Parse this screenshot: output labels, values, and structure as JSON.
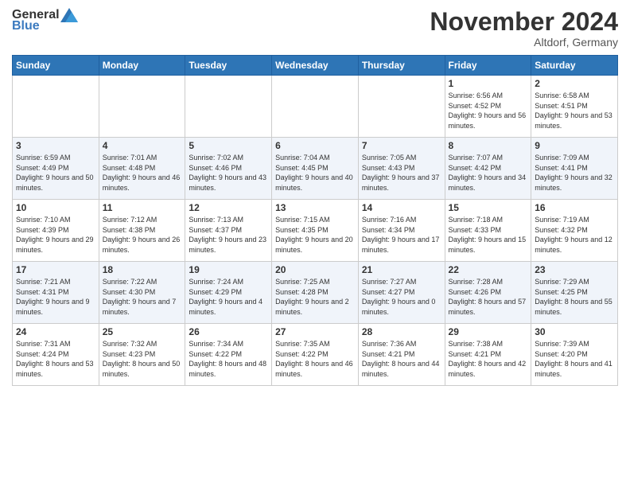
{
  "header": {
    "logo_general": "General",
    "logo_blue": "Blue",
    "month_title": "November 2024",
    "location": "Altdorf, Germany"
  },
  "weekdays": [
    "Sunday",
    "Monday",
    "Tuesday",
    "Wednesday",
    "Thursday",
    "Friday",
    "Saturday"
  ],
  "weeks": [
    [
      {
        "day": "",
        "info": ""
      },
      {
        "day": "",
        "info": ""
      },
      {
        "day": "",
        "info": ""
      },
      {
        "day": "",
        "info": ""
      },
      {
        "day": "",
        "info": ""
      },
      {
        "day": "1",
        "info": "Sunrise: 6:56 AM\nSunset: 4:52 PM\nDaylight: 9 hours and 56 minutes."
      },
      {
        "day": "2",
        "info": "Sunrise: 6:58 AM\nSunset: 4:51 PM\nDaylight: 9 hours and 53 minutes."
      }
    ],
    [
      {
        "day": "3",
        "info": "Sunrise: 6:59 AM\nSunset: 4:49 PM\nDaylight: 9 hours and 50 minutes."
      },
      {
        "day": "4",
        "info": "Sunrise: 7:01 AM\nSunset: 4:48 PM\nDaylight: 9 hours and 46 minutes."
      },
      {
        "day": "5",
        "info": "Sunrise: 7:02 AM\nSunset: 4:46 PM\nDaylight: 9 hours and 43 minutes."
      },
      {
        "day": "6",
        "info": "Sunrise: 7:04 AM\nSunset: 4:45 PM\nDaylight: 9 hours and 40 minutes."
      },
      {
        "day": "7",
        "info": "Sunrise: 7:05 AM\nSunset: 4:43 PM\nDaylight: 9 hours and 37 minutes."
      },
      {
        "day": "8",
        "info": "Sunrise: 7:07 AM\nSunset: 4:42 PM\nDaylight: 9 hours and 34 minutes."
      },
      {
        "day": "9",
        "info": "Sunrise: 7:09 AM\nSunset: 4:41 PM\nDaylight: 9 hours and 32 minutes."
      }
    ],
    [
      {
        "day": "10",
        "info": "Sunrise: 7:10 AM\nSunset: 4:39 PM\nDaylight: 9 hours and 29 minutes."
      },
      {
        "day": "11",
        "info": "Sunrise: 7:12 AM\nSunset: 4:38 PM\nDaylight: 9 hours and 26 minutes."
      },
      {
        "day": "12",
        "info": "Sunrise: 7:13 AM\nSunset: 4:37 PM\nDaylight: 9 hours and 23 minutes."
      },
      {
        "day": "13",
        "info": "Sunrise: 7:15 AM\nSunset: 4:35 PM\nDaylight: 9 hours and 20 minutes."
      },
      {
        "day": "14",
        "info": "Sunrise: 7:16 AM\nSunset: 4:34 PM\nDaylight: 9 hours and 17 minutes."
      },
      {
        "day": "15",
        "info": "Sunrise: 7:18 AM\nSunset: 4:33 PM\nDaylight: 9 hours and 15 minutes."
      },
      {
        "day": "16",
        "info": "Sunrise: 7:19 AM\nSunset: 4:32 PM\nDaylight: 9 hours and 12 minutes."
      }
    ],
    [
      {
        "day": "17",
        "info": "Sunrise: 7:21 AM\nSunset: 4:31 PM\nDaylight: 9 hours and 9 minutes."
      },
      {
        "day": "18",
        "info": "Sunrise: 7:22 AM\nSunset: 4:30 PM\nDaylight: 9 hours and 7 minutes."
      },
      {
        "day": "19",
        "info": "Sunrise: 7:24 AM\nSunset: 4:29 PM\nDaylight: 9 hours and 4 minutes."
      },
      {
        "day": "20",
        "info": "Sunrise: 7:25 AM\nSunset: 4:28 PM\nDaylight: 9 hours and 2 minutes."
      },
      {
        "day": "21",
        "info": "Sunrise: 7:27 AM\nSunset: 4:27 PM\nDaylight: 9 hours and 0 minutes."
      },
      {
        "day": "22",
        "info": "Sunrise: 7:28 AM\nSunset: 4:26 PM\nDaylight: 8 hours and 57 minutes."
      },
      {
        "day": "23",
        "info": "Sunrise: 7:29 AM\nSunset: 4:25 PM\nDaylight: 8 hours and 55 minutes."
      }
    ],
    [
      {
        "day": "24",
        "info": "Sunrise: 7:31 AM\nSunset: 4:24 PM\nDaylight: 8 hours and 53 minutes."
      },
      {
        "day": "25",
        "info": "Sunrise: 7:32 AM\nSunset: 4:23 PM\nDaylight: 8 hours and 50 minutes."
      },
      {
        "day": "26",
        "info": "Sunrise: 7:34 AM\nSunset: 4:22 PM\nDaylight: 8 hours and 48 minutes."
      },
      {
        "day": "27",
        "info": "Sunrise: 7:35 AM\nSunset: 4:22 PM\nDaylight: 8 hours and 46 minutes."
      },
      {
        "day": "28",
        "info": "Sunrise: 7:36 AM\nSunset: 4:21 PM\nDaylight: 8 hours and 44 minutes."
      },
      {
        "day": "29",
        "info": "Sunrise: 7:38 AM\nSunset: 4:21 PM\nDaylight: 8 hours and 42 minutes."
      },
      {
        "day": "30",
        "info": "Sunrise: 7:39 AM\nSunset: 4:20 PM\nDaylight: 8 hours and 41 minutes."
      }
    ]
  ]
}
